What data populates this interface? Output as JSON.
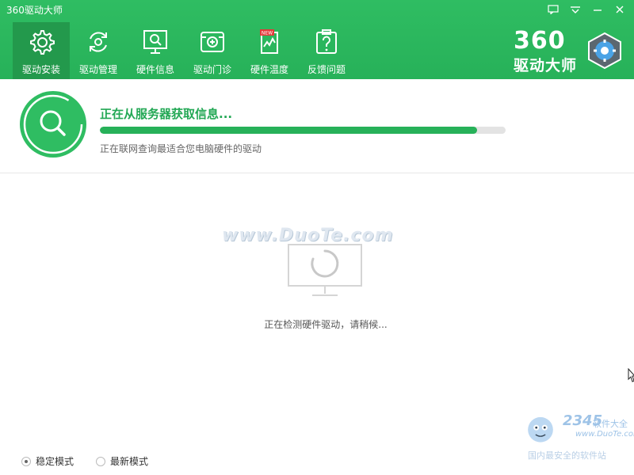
{
  "window": {
    "title": "360驱动大师",
    "controls": [
      "feedback-icon",
      "menu-icon",
      "minimize-icon",
      "close-icon"
    ]
  },
  "tabs": [
    {
      "label": "驱动安装",
      "icon": "gear-icon",
      "active": true
    },
    {
      "label": "驱动管理",
      "icon": "refresh-icon",
      "active": false
    },
    {
      "label": "硬件信息",
      "icon": "monitor-search-icon",
      "active": false
    },
    {
      "label": "驱动门诊",
      "icon": "clinic-icon",
      "active": false
    },
    {
      "label": "硬件温度",
      "icon": "thermometer-new-icon",
      "active": false
    },
    {
      "label": "反馈问题",
      "icon": "question-icon",
      "active": false
    }
  ],
  "brand": {
    "number": "360",
    "name": "驱动大师"
  },
  "status": {
    "title": "正在从服务器获取信息...",
    "subtitle": "正在联网查询最适合您电脑硬件的驱动",
    "progress": 0.93
  },
  "content": {
    "watermark": "www.DuoTe.com",
    "detecting_text": "正在检测硬件驱动，请稍候..."
  },
  "corner": {
    "number": "2345",
    "text": "软件大全",
    "url": "www.DuoTe.com",
    "sub": "国内最安全的软件站"
  },
  "footer": {
    "modes": [
      {
        "label": "稳定模式",
        "selected": true
      },
      {
        "label": "最新模式",
        "selected": false
      }
    ]
  },
  "colors": {
    "accent": "#27b159",
    "accent_dark": "#23994c",
    "text_green": "#23a855"
  }
}
